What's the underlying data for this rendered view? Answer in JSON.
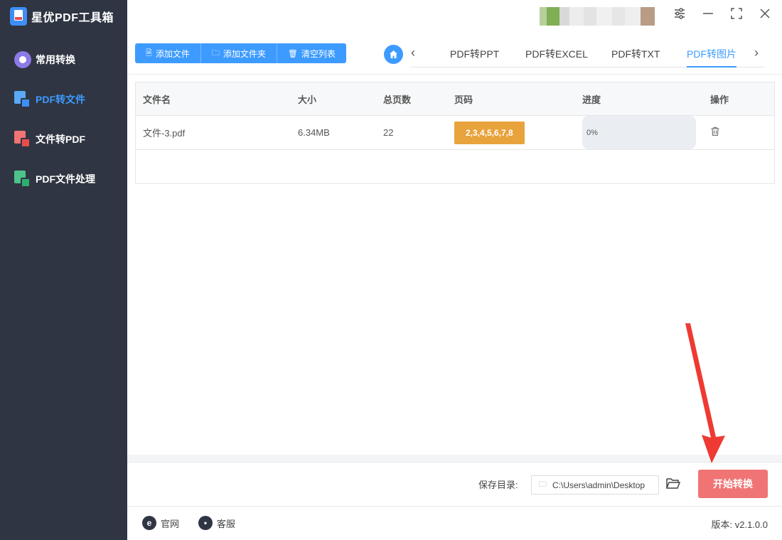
{
  "app": {
    "title": "星优PDF工具箱"
  },
  "sidebar": {
    "items": [
      {
        "label": "常用转换",
        "active": false
      },
      {
        "label": "PDF转文件",
        "active": true
      },
      {
        "label": "文件转PDF",
        "active": false
      },
      {
        "label": "PDF文件处理",
        "active": false
      }
    ]
  },
  "toolbar": {
    "add_file": "添加文件",
    "add_folder": "添加文件夹",
    "clear_list": "清空列表"
  },
  "tabs": [
    {
      "label": "PDF转PPT",
      "active": false
    },
    {
      "label": "PDF转EXCEL",
      "active": false
    },
    {
      "label": "PDF转TXT",
      "active": false
    },
    {
      "label": "PDF转图片",
      "active": true
    }
  ],
  "table": {
    "headers": [
      "文件名",
      "大小",
      "总页数",
      "页码",
      "进度",
      "操作"
    ],
    "rows": [
      {
        "name": "文件-3.pdf",
        "size": "6.34MB",
        "pages": "22",
        "page_range": "2,3,4,5,6,7,8",
        "progress_label": "0%",
        "progress_value": 0
      }
    ]
  },
  "save": {
    "label": "保存目录:",
    "path": "C:\\Users\\admin\\Desktop"
  },
  "start_button": "开始转换",
  "footer": {
    "website": "官网",
    "support": "客服",
    "version": "版本: v2.1.0.0"
  },
  "colors": {
    "sidebar_bg": "#2f3542",
    "accent": "#3d9bff",
    "start_button": "#f07474",
    "page_badge": "#e8a33d",
    "annotation_arrow": "#ee3a33"
  },
  "icons": {
    "window": [
      "settings-sliders-icon",
      "minimize-icon",
      "maximize-icon",
      "close-icon"
    ],
    "footer": [
      "ie-icon",
      "chat-icon"
    ]
  }
}
